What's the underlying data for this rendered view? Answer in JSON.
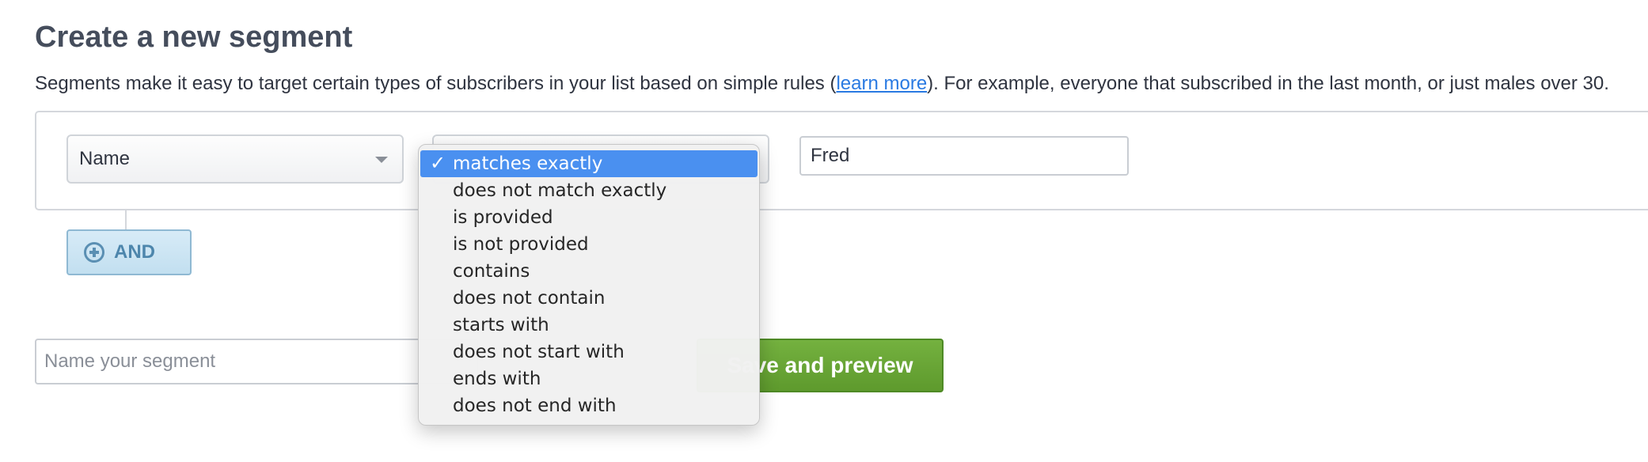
{
  "header": {
    "title": "Create a new segment",
    "description_before": "Segments make it easy to target certain types of subscribers in your list based on simple rules (",
    "learn_more": "learn more",
    "description_after": "). For example, everyone that subscribed in the last month, or just males over 30."
  },
  "rule": {
    "field_value": "Name",
    "operator_value": "matches exactly",
    "text_value": "Fred"
  },
  "and_button": {
    "label": "AND",
    "icon": "plus-circle-icon"
  },
  "segment_name": {
    "placeholder": "Name your segment",
    "value": ""
  },
  "save_button": {
    "label": "Save and preview"
  },
  "operator_menu": {
    "check_icon": "checkmark-icon",
    "check_glyph": "✓",
    "selected_index": 0,
    "options": [
      "matches exactly",
      "does not match exactly",
      "is provided",
      "is not provided",
      "contains",
      "does not contain",
      "starts with",
      "does not start with",
      "ends with",
      "does not end with"
    ]
  },
  "colors": {
    "save_button": "#67a636",
    "and_button": "#c8e3f3",
    "menu_highlight": "#4a90f0",
    "link": "#2a7ae2"
  }
}
